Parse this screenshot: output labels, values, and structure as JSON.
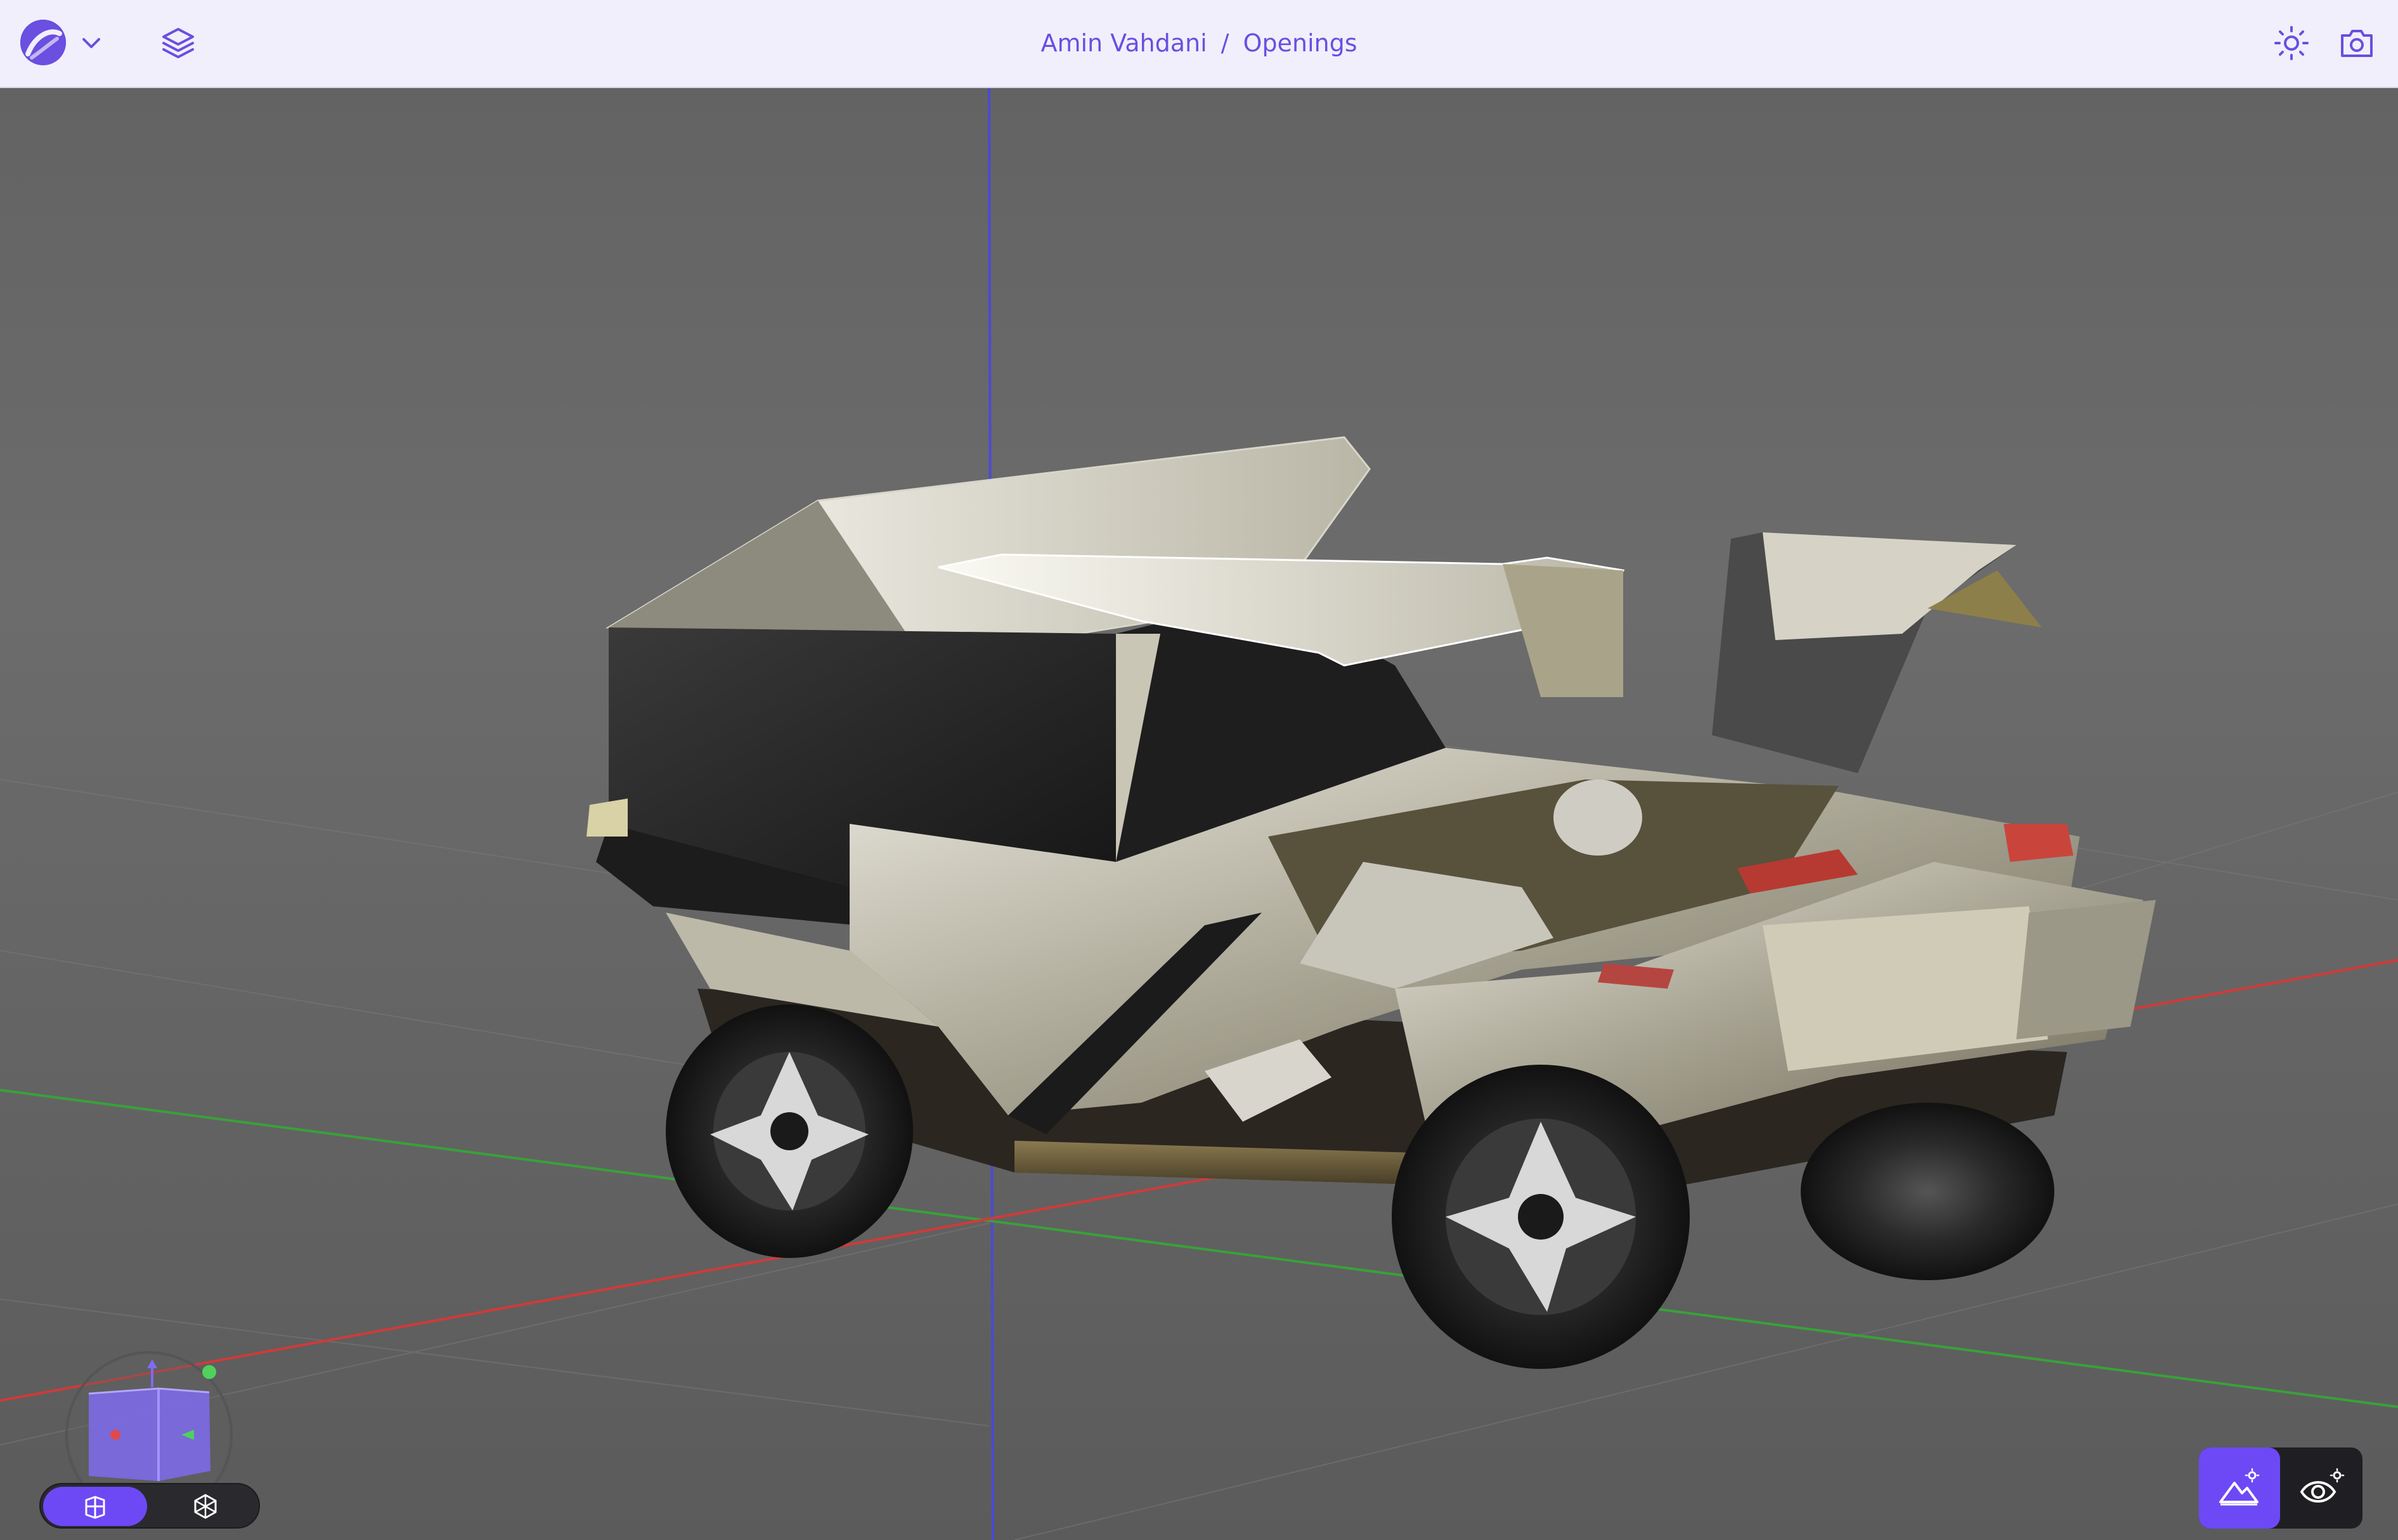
{
  "app": {
    "brand_color": "#6a4fe0",
    "accent_color": "#6d49f6"
  },
  "header": {
    "breadcrumb": {
      "owner": "Amin Vahdani",
      "separator": "/",
      "project": "Openings"
    },
    "icons": {
      "logo": "app-logo-icon",
      "menu": "chevron-down-icon",
      "layers": "layers-icon",
      "lighting": "sun-icon",
      "screenshot": "camera-icon"
    }
  },
  "viewport": {
    "background_color": "#676767",
    "axes": {
      "x_color": "#d03a3a",
      "y_color": "#3aa03a",
      "z_color": "#4a4ad6"
    },
    "model": "3D vehicle model with open doors"
  },
  "view_toggle": {
    "options": [
      {
        "icon": "grid-view-icon",
        "active": true
      },
      {
        "icon": "wireframe-icon",
        "active": false
      }
    ]
  },
  "environment_toggle": {
    "options": [
      {
        "icon": "environment-icon",
        "active": true
      },
      {
        "icon": "visibility-settings-icon",
        "active": false
      }
    ]
  }
}
